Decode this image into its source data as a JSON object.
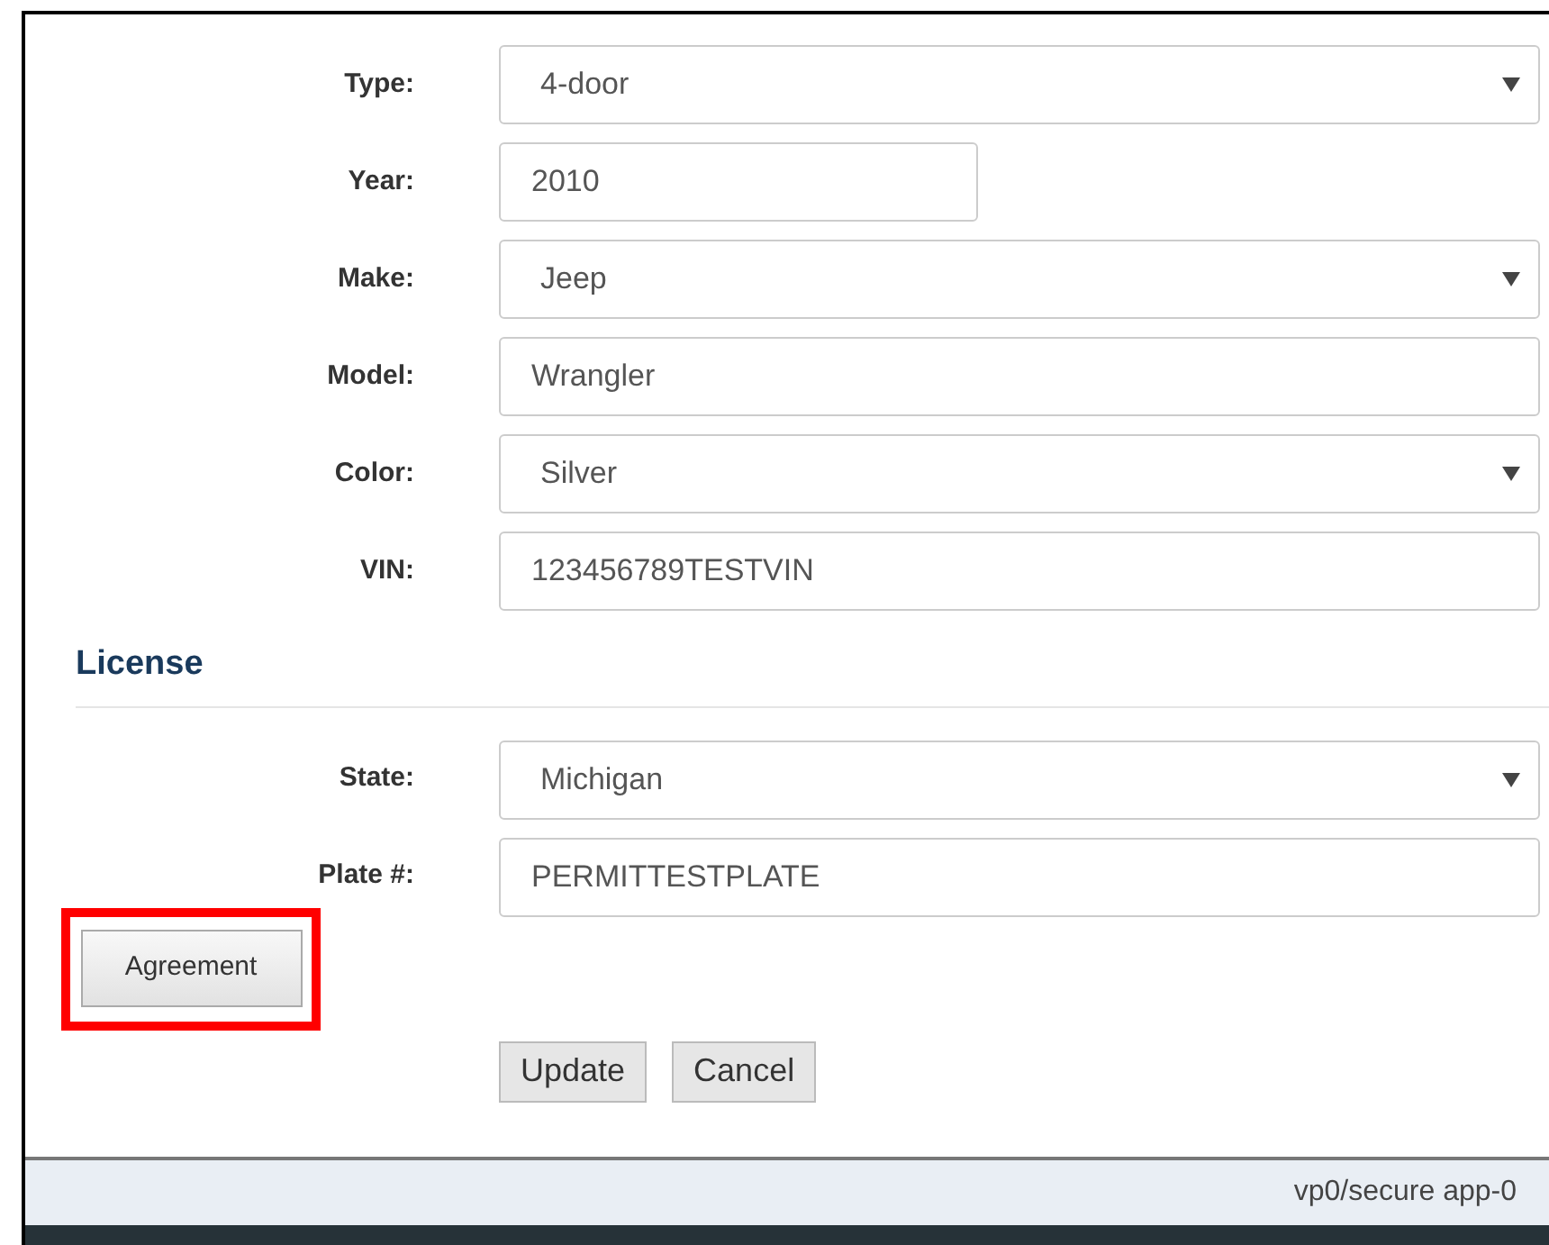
{
  "vehicle_fields": [
    {
      "label": "Type:",
      "kind": "select",
      "value": "4-door"
    },
    {
      "label": "Year:",
      "kind": "short",
      "value": "2010"
    },
    {
      "label": "Make:",
      "kind": "select",
      "value": "Jeep"
    },
    {
      "label": "Model:",
      "kind": "text",
      "value": "Wrangler"
    },
    {
      "label": "Color:",
      "kind": "select",
      "value": "Silver"
    },
    {
      "label": "VIN:",
      "kind": "text",
      "value": "123456789TESTVIN"
    }
  ],
  "license": {
    "heading": "License",
    "fields": [
      {
        "label": "State:",
        "kind": "select",
        "value": "Michigan"
      },
      {
        "label": "Plate #:",
        "kind": "text",
        "value": "PERMITTESTPLATE"
      }
    ]
  },
  "agreement_button": {
    "label": "Agreement",
    "highlighted": true
  },
  "buttons": [
    "Update",
    "Cancel"
  ],
  "footer": "vp0/secure app-0"
}
